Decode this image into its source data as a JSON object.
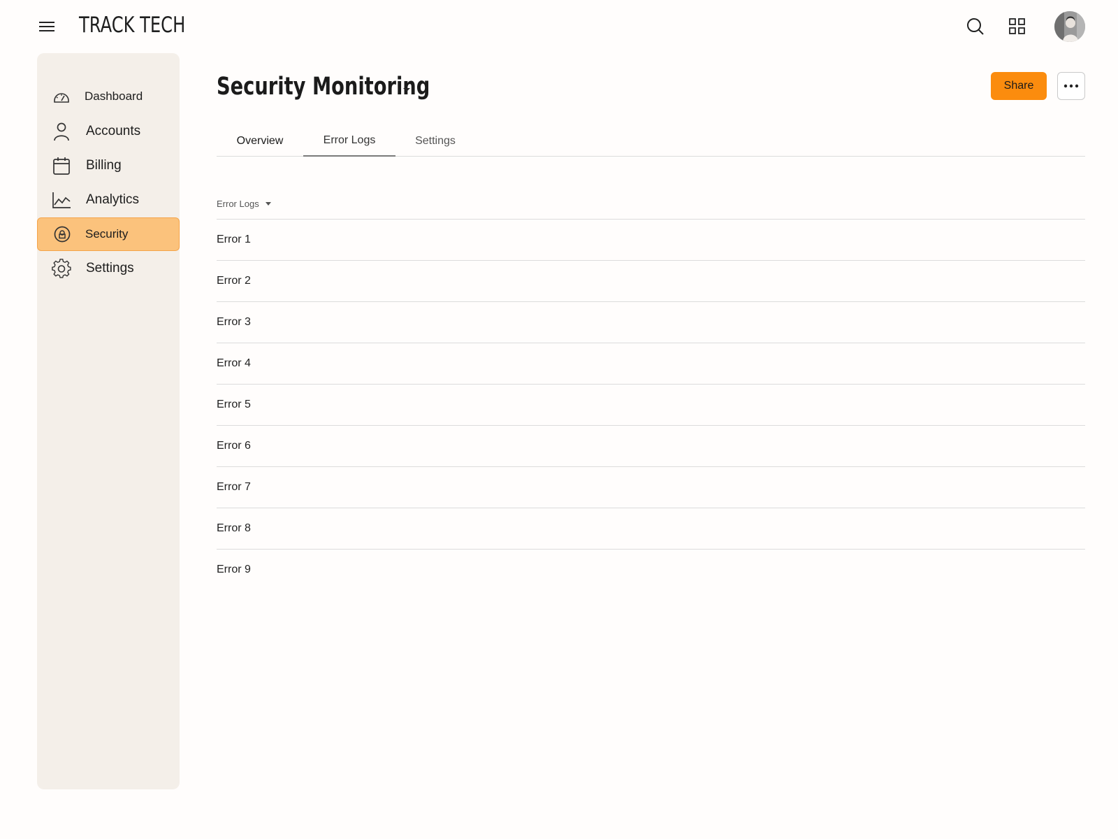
{
  "app": {
    "logo": "TRACK TECH",
    "accent_color": "#fb8c0e",
    "active_nav_bg": "#fbc27c"
  },
  "topbar": {
    "icons": [
      "menu-icon",
      "search-icon",
      "grid-icon",
      "avatar"
    ]
  },
  "sidebar": {
    "items": [
      {
        "label": "Dashboard",
        "icon": "gauge-icon"
      },
      {
        "label": "Accounts",
        "icon": "user-icon"
      },
      {
        "label": "Billing",
        "icon": "calendar-icon"
      },
      {
        "label": "Analytics",
        "icon": "line-chart-icon"
      },
      {
        "label": "Security",
        "icon": "shield-lock-icon",
        "active": true
      },
      {
        "label": "Settings",
        "icon": "gear-icon"
      }
    ]
  },
  "header": {
    "title": "Security Monitoring",
    "share_label": "Share"
  },
  "tabs": [
    {
      "label": "Overview"
    },
    {
      "label": "Error Logs",
      "active": true
    },
    {
      "label": "Settings"
    }
  ],
  "list": {
    "header": "Error Logs",
    "items": [
      "Error 1",
      "Error 2",
      "Error 3",
      "Error 4",
      "Error 5",
      "Error 6",
      "Error 7",
      "Error 8",
      "Error 9"
    ]
  }
}
